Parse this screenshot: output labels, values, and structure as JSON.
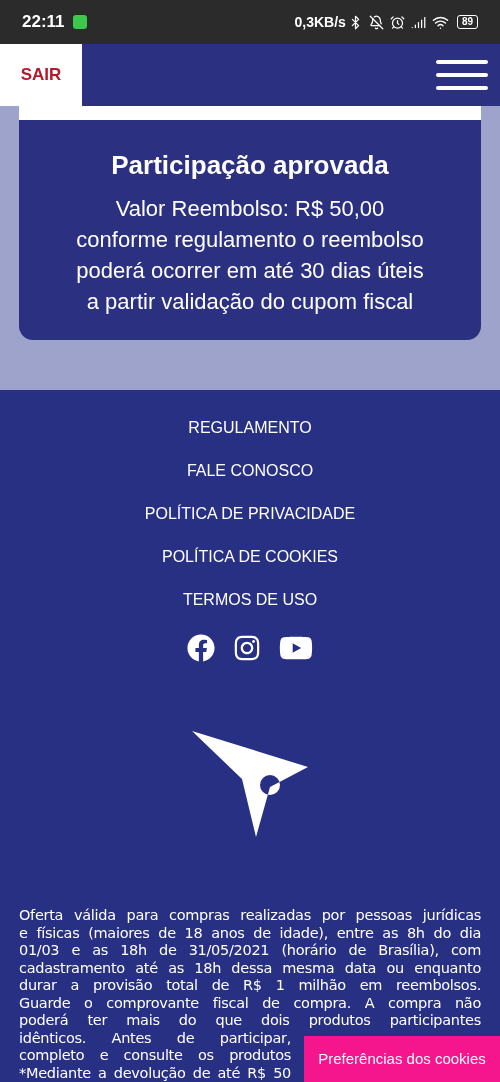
{
  "status_bar": {
    "time": "22:11",
    "speed": "0,3KB/s",
    "battery": "89"
  },
  "header": {
    "exit_label": "SAIR"
  },
  "card": {
    "title": "Participação aprovada",
    "lines": [
      "Valor Reembolso: R$ 50,00",
      "conforme regulamento o reembolso",
      "poderá ocorrer em até 30 dias úteis",
      "a partir validação do cupom fiscal"
    ]
  },
  "footer": {
    "links": [
      "REGULAMENTO",
      "FALE CONOSCO",
      "POLÍTICA DE PRIVACIDADE",
      "POLÍTICA DE COOKIES",
      "TERMOS DE USO"
    ],
    "social": [
      {
        "kind": "facebook"
      },
      {
        "kind": "instagram"
      },
      {
        "kind": "youtube"
      }
    ],
    "disclaimer_lines": [
      "Oferta válida para compras realizadas por pessoas jurídicas",
      "e físicas (maiores de 18 anos de idade), entre as 8h do dia",
      "01/03 e as 18h de 31/05/2021 (horário de Brasília), com",
      "cadastramento até as 18h dessa mesma data ou enquanto",
      "durar a provisão total de R$ 1 milhão em reembolsos.",
      "Guarde o comprovante fiscal de compra. A compra não",
      "poderá ter mais do que dois produtos participantes"
    ],
    "disclaimer_cut_lines": [
      "idênticos. Antes de participar,",
      "completo e consulte os produtos",
      "*Mediante a devolução de até R$ 50"
    ]
  },
  "cookie_button": "Preferências dos cookies"
}
